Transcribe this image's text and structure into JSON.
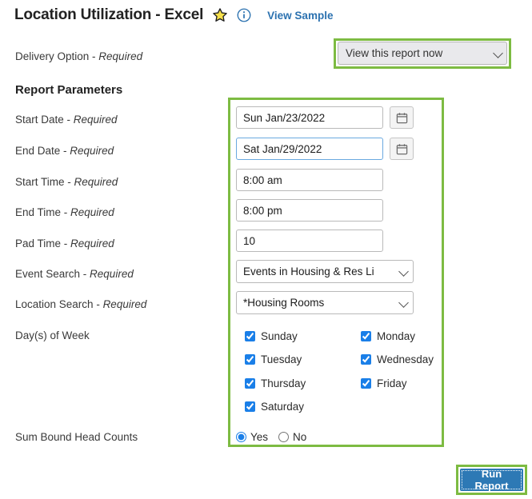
{
  "header": {
    "title": "Location Utilization - Excel",
    "favorite_icon": "star-icon",
    "info_icon": "info-circle-icon",
    "view_sample_label": "View Sample"
  },
  "colors": {
    "highlight_green": "#7dbb42",
    "link_blue": "#2c72b0",
    "button_blue": "#2d79b5",
    "checkbox_blue": "#1a7fe8",
    "star_yellow": "#f6e04b",
    "focus_blue": "#6aa9e0"
  },
  "labels": {
    "delivery_option": "Delivery Option - ",
    "delivery_option_req": "Required",
    "report_parameters": "Report Parameters",
    "start_date": "Start Date - ",
    "start_date_req": "Required",
    "end_date": "End Date - ",
    "end_date_req": "Required",
    "start_time": "Start Time - ",
    "start_time_req": "Required",
    "end_time": "End Time - ",
    "end_time_req": "Required",
    "pad_time": "Pad Time - ",
    "pad_time_req": "Required",
    "event_search": "Event Search - ",
    "event_search_req": "Required",
    "location_search": "Location Search - ",
    "location_search_req": "Required",
    "days_of_week": "Day(s) of Week",
    "sum_bound_head_counts": "Sum Bound Head Counts"
  },
  "fields": {
    "delivery_option": {
      "value": "View this report now",
      "options": [
        "View this report now"
      ]
    },
    "start_date": {
      "value": "Sun Jan/23/2022",
      "calendar_icon": "calendar-icon"
    },
    "end_date": {
      "value": "Sat Jan/29/2022",
      "calendar_icon": "calendar-icon",
      "focused": true
    },
    "start_time": {
      "value": "8:00 am"
    },
    "end_time": {
      "value": "8:00 pm"
    },
    "pad_time": {
      "value": "10"
    },
    "event_search": {
      "value": "Events in Housing & Res Li",
      "options": [
        "Events in Housing & Res Li"
      ]
    },
    "location_search": {
      "value": "*Housing Rooms",
      "options": [
        "*Housing Rooms"
      ]
    },
    "sum_bound_head_counts": {
      "value": "Yes",
      "options": [
        {
          "label": "Yes",
          "checked": true
        },
        {
          "label": "No",
          "checked": false
        }
      ]
    }
  },
  "days": [
    {
      "label": "Sunday",
      "checked": true,
      "col": 0,
      "row": 0
    },
    {
      "label": "Monday",
      "checked": true,
      "col": 1,
      "row": 0
    },
    {
      "label": "Tuesday",
      "checked": true,
      "col": 0,
      "row": 1
    },
    {
      "label": "Wednesday",
      "checked": true,
      "col": 1,
      "row": 1
    },
    {
      "label": "Thursday",
      "checked": true,
      "col": 0,
      "row": 2
    },
    {
      "label": "Friday",
      "checked": true,
      "col": 1,
      "row": 2
    },
    {
      "label": "Saturday",
      "checked": true,
      "col": 0,
      "row": 3
    }
  ],
  "actions": {
    "run_report_label": "Run Report"
  }
}
